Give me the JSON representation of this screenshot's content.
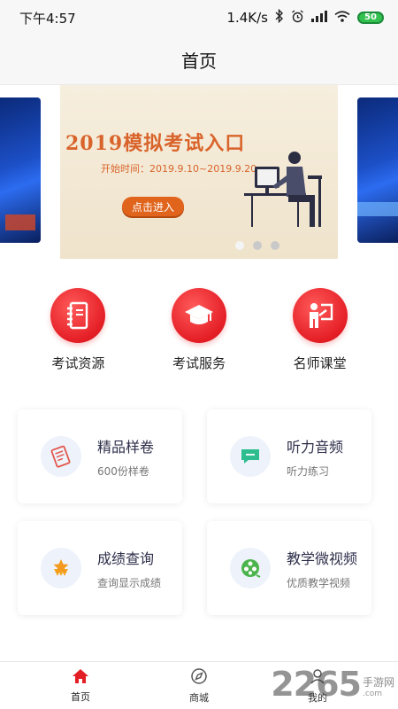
{
  "status_bar": {
    "time": "下午4:57",
    "network_speed": "1.4K/s",
    "battery_level": "50",
    "icons": [
      "bluetooth-icon",
      "alarm-icon",
      "signal-icon",
      "wifi-icon",
      "battery-icon"
    ]
  },
  "header": {
    "title": "首页"
  },
  "banner": {
    "headline": "2019模拟考试入口",
    "subline": "开始时间：2019.9.10~2019.9.20",
    "button_label": "点击进入",
    "accent_color": "#e0641c",
    "page_count": 3,
    "active_index": 0
  },
  "shortcuts": [
    {
      "label": "考试资源",
      "icon": "notebook-icon"
    },
    {
      "label": "考试服务",
      "icon": "graduation-cap-icon"
    },
    {
      "label": "名师课堂",
      "icon": "teacher-icon"
    }
  ],
  "cards": [
    {
      "title": "精品样卷",
      "subtitle": "600份样卷",
      "icon": "exam-paper-icon"
    },
    {
      "title": "听力音频",
      "subtitle": "听力练习",
      "icon": "chat-bubble-icon"
    },
    {
      "title": "成绩查询",
      "subtitle": "查询显示成绩",
      "icon": "award-star-icon"
    },
    {
      "title": "教学微视频",
      "subtitle": "优质教学视频",
      "icon": "film-reel-icon"
    }
  ],
  "tabs": [
    {
      "label": "首页",
      "icon": "home-icon",
      "active": true
    },
    {
      "label": "商城",
      "icon": "compass-icon",
      "active": false
    },
    {
      "label": "我的",
      "icon": "user-icon",
      "active": false
    }
  ],
  "watermark": {
    "number": "2265",
    "text": "手游网",
    "domain": ".com"
  },
  "colors": {
    "brand_red": "#e41e25",
    "tab_active": "#e41e25"
  }
}
